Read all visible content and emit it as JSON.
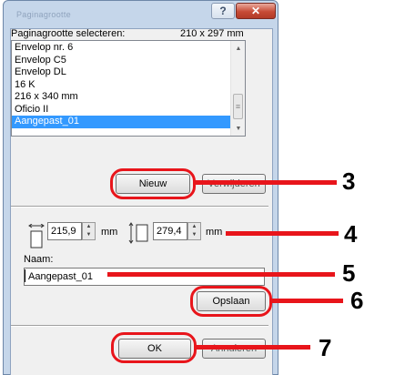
{
  "window": {
    "title": "Paginagrootte",
    "help_glyph": "?",
    "close_glyph": "✕"
  },
  "paper_size": {
    "label": "Paginagrootte selecteren:",
    "dimensions": "210 x 297 mm",
    "items": [
      "Envelop nr. 6",
      "Envelop C5",
      "Envelop DL",
      "16 K",
      "216 x 340 mm",
      "Oficio II",
      "Aangepast_01"
    ],
    "selected_index": 6
  },
  "buttons": {
    "new": "Nieuw",
    "delete": "Verwijderen",
    "save": "Opslaan",
    "ok": "OK",
    "cancel": "Annuleren"
  },
  "size": {
    "width_value": "215,9",
    "height_value": "279,4",
    "unit": "mm"
  },
  "name": {
    "label": "Naam:",
    "value": "Aangepast_01"
  },
  "callouts": [
    "3",
    "4",
    "5",
    "6",
    "7"
  ],
  "colors": {
    "highlight": "#e8151b",
    "selection": "#3399ff"
  }
}
